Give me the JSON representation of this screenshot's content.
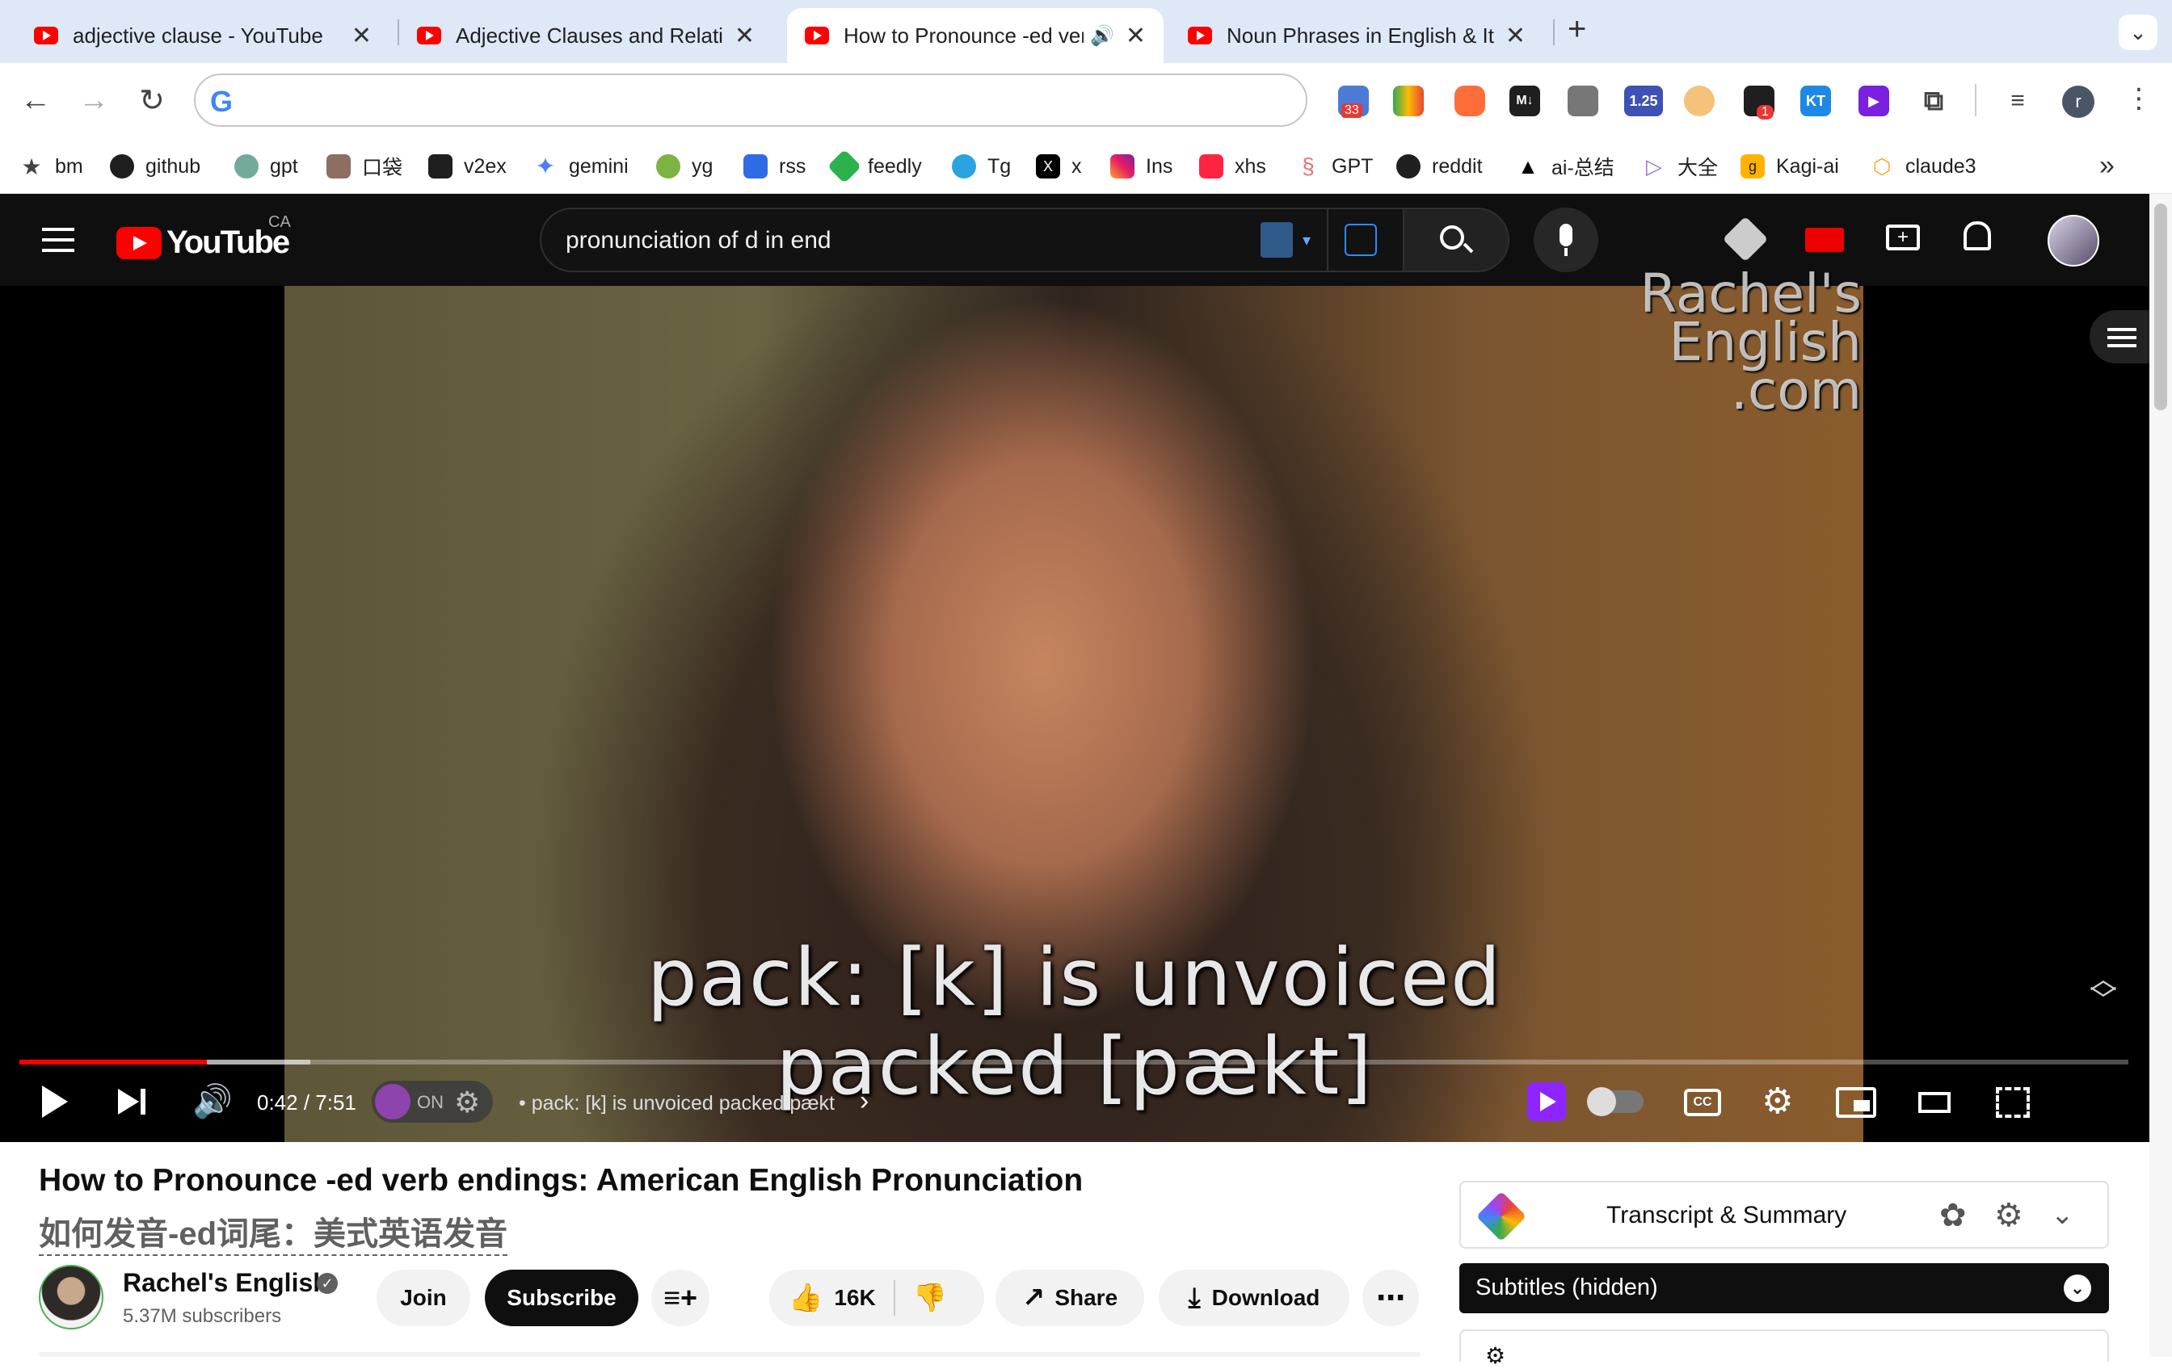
{
  "tabs": [
    {
      "title": "adjective clause - YouTube",
      "active": false
    },
    {
      "title": "Adjective Clauses and Relative",
      "active": false
    },
    {
      "title": "How to Pronounce -ed verb",
      "active": true,
      "audio": true
    },
    {
      "title": "Noun Phrases in English & Its",
      "active": false
    }
  ],
  "toolbar": {
    "omnibox_value": "",
    "ext_badge_1": "33",
    "ext_speed": "1.25",
    "ext_badge_2": "1",
    "ext_md": "M↓",
    "ext_kt": "KT",
    "profile_initial": "r"
  },
  "bookmarks": [
    {
      "label": "bm",
      "icon": "star-icon"
    },
    {
      "label": "github",
      "icon": "github-icon"
    },
    {
      "label": "gpt",
      "icon": "openai-icon"
    },
    {
      "label": "口袋",
      "icon": "folder-icon"
    },
    {
      "label": "v2ex",
      "icon": "v2ex-icon"
    },
    {
      "label": "gemini",
      "icon": "gemini-icon"
    },
    {
      "label": "yg",
      "icon": "yg-icon"
    },
    {
      "label": "rss",
      "icon": "rss-icon"
    },
    {
      "label": "feedly",
      "icon": "feedly-icon"
    },
    {
      "label": "Tg",
      "icon": "telegram-icon"
    },
    {
      "label": "x",
      "icon": "x-icon"
    },
    {
      "label": "Ins",
      "icon": "instagram-icon"
    },
    {
      "label": "xhs",
      "icon": "xhs-icon"
    },
    {
      "label": "GPT",
      "icon": "gpt-icon"
    },
    {
      "label": "reddit",
      "icon": "reddit-icon"
    },
    {
      "label": "ai-总结",
      "icon": "ai-icon"
    },
    {
      "label": "大全",
      "icon": "play-icon"
    },
    {
      "label": "Kagi-ai",
      "icon": "kagi-icon"
    },
    {
      "label": "claude3",
      "icon": "claude-icon"
    }
  ],
  "youtube": {
    "logo_text": "YouTube",
    "country": "CA",
    "search_value": "pronunciation of d in end"
  },
  "video": {
    "watermark": "Rachel's English .com",
    "caption_line1": "pack:  [k] is unvoiced",
    "caption_line2": "packed [pækt]",
    "time": "0:42 / 7:51",
    "played_fraction": 0.089,
    "lr_status": "ON",
    "chapter": "• pack: [k] is unvoiced packed pækt",
    "cc_label": "CC"
  },
  "meta": {
    "title": "How to Pronounce -ed verb endings: American English Pronunciation",
    "title_zh": "如何发音-ed词尾：美式英语发音",
    "channel": "Rachel's English",
    "subscribers": "5.37M subscribers",
    "join": "Join",
    "subscribe": "Subscribe",
    "likes": "16K",
    "share": "Share",
    "download": "Download"
  },
  "side": {
    "transcript_title": "Transcript & Summary",
    "subtitles": "Subtitles (hidden)"
  }
}
